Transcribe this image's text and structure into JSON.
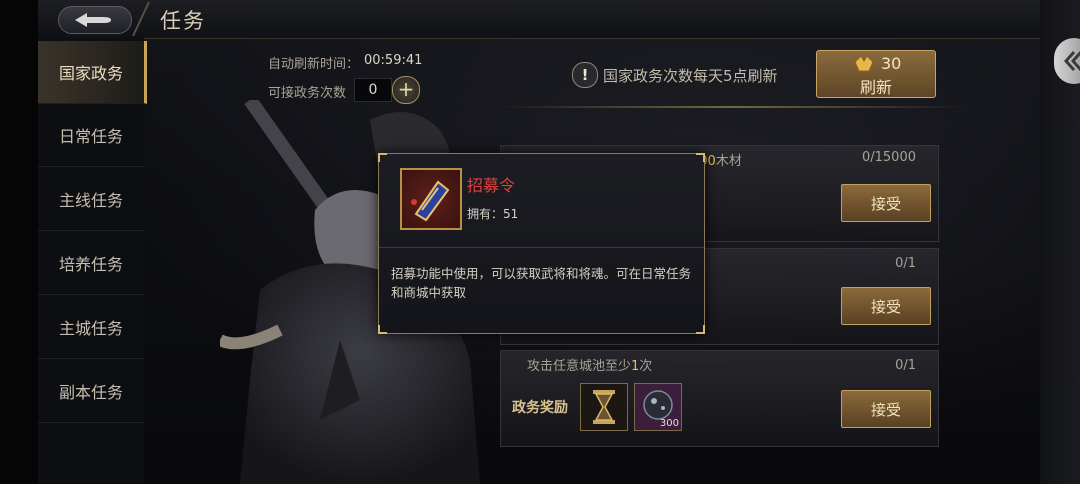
{
  "header": {
    "title": "任务",
    "back_icon": "back-arrow-icon"
  },
  "sidebar": {
    "items": [
      {
        "label": "国家政务",
        "active": true
      },
      {
        "label": "日常任务",
        "active": false
      },
      {
        "label": "主线任务",
        "active": false
      },
      {
        "label": "培养任务",
        "active": false
      },
      {
        "label": "主城任务",
        "active": false
      },
      {
        "label": "副本任务",
        "active": false
      }
    ]
  },
  "info": {
    "refresh_time_label": "自动刷新时间：",
    "refresh_time_value": "00:59:41",
    "accept_count_label": "可接政务次数",
    "accept_count_value": "0",
    "notice": "国家政务次数每天5点刷新"
  },
  "refresh_button": {
    "cost": "30",
    "label": "刷新",
    "cost_icon": "gold-ingot-icon"
  },
  "tasks": [
    {
      "desc_suffix": "000",
      "desc_tail": "木材",
      "progress": "0/15000",
      "button": "接受"
    },
    {
      "progress": "0/1",
      "button": "接受"
    },
    {
      "desc_prefix": "攻击任意城池至少",
      "desc_highlight": "1",
      "desc_tail": "次",
      "progress": "0/1",
      "reward_label": "政务奖励",
      "reward_qty": "300",
      "button": "接受"
    }
  ],
  "tooltip": {
    "name": "招募令",
    "own_label": "拥有：",
    "own_value": "51",
    "description": "招募功能中使用，可以获取武将和将魂。可在日常任务和商城中获取"
  },
  "colors": {
    "accent_gold": "#c9a45a",
    "item_name_red": "#e0403a",
    "highlight_yellow": "#e3c15e"
  }
}
